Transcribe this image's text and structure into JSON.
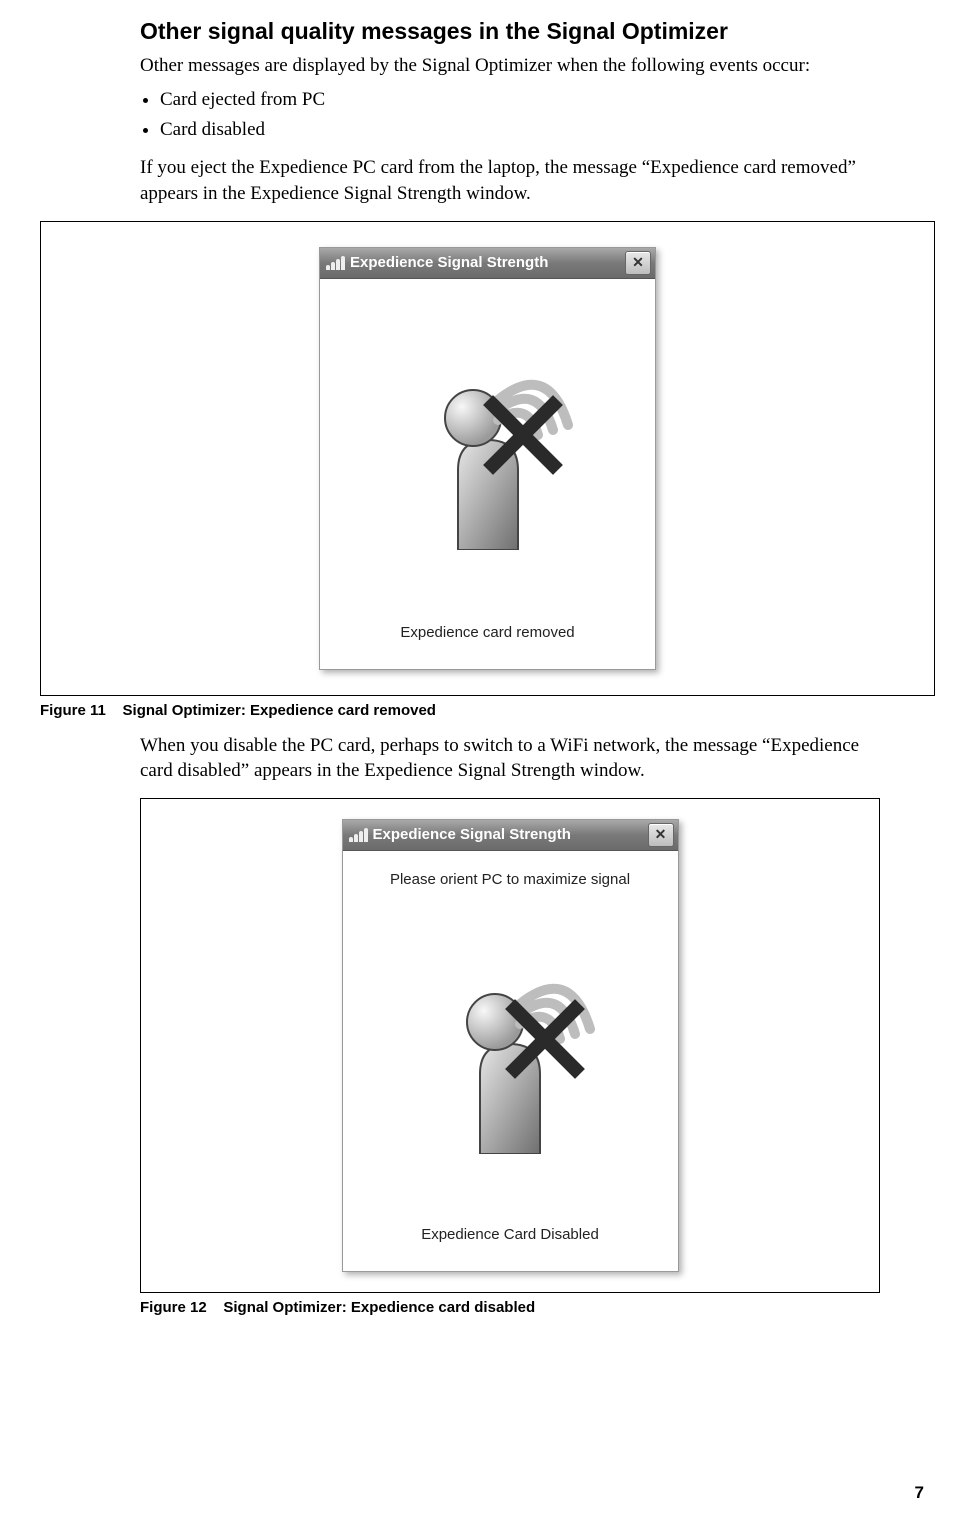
{
  "heading": "Other signal quality messages in the Signal Optimizer",
  "intro": "Other messages are displayed by the Signal Optimizer when the following events occur:",
  "bullets": [
    "Card ejected from PC",
    "Card disabled"
  ],
  "para_eject": "If you eject the Expedience PC card from the laptop, the message “Expedience card removed” appears in the Expedience Signal Strength window.",
  "para_disable": "When you disable the PC card, perhaps to switch to a WiFi network, the message “Expedience card disabled” appears in the Expedience Signal Strength window.",
  "fig11": {
    "caption_prefix": "Figure 11",
    "caption_text": "Signal Optimizer: Expedience card removed",
    "window_title": "Expedience Signal Strength",
    "status": "Expedience card removed"
  },
  "fig12": {
    "caption_prefix": "Figure 12",
    "caption_text": "Signal Optimizer: Expedience card disabled",
    "window_title": "Expedience Signal Strength",
    "hint": "Please orient PC to maximize signal",
    "status": "Expedience Card Disabled"
  },
  "close_glyph": "✕",
  "page_number": "7"
}
